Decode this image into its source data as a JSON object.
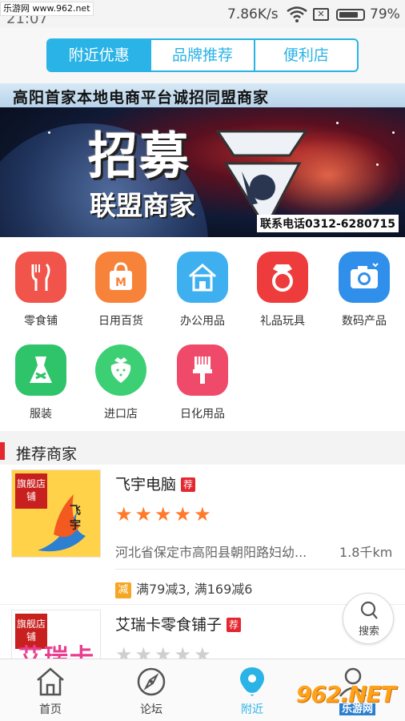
{
  "status_bar": {
    "watermark": "乐游网 www.962.net",
    "time": "21:07",
    "net_speed": "7.86K/s",
    "battery": "79%",
    "icons": [
      "wifi-icon",
      "sim-off-icon",
      "battery-icon"
    ]
  },
  "tabs": [
    {
      "label": "附近优惠",
      "active": true
    },
    {
      "label": "品牌推荐",
      "active": false
    },
    {
      "label": "便利店",
      "active": false
    }
  ],
  "banner": {
    "top_text": "高阳首家本地电商平台诚招同盟商家",
    "headline": "招募",
    "subline": "联盟商家",
    "phone": "联系电话0312-6280715"
  },
  "categories": [
    {
      "label": "零食铺",
      "icon": "fork-knife-icon",
      "color": "#f0544a"
    },
    {
      "label": "日用百货",
      "icon": "shopping-bag-icon",
      "color": "#f7823a"
    },
    {
      "label": "办公用品",
      "icon": "house-icon",
      "color": "#3eb0f0"
    },
    {
      "label": "礼品玩具",
      "icon": "ring-icon",
      "color": "#ee3b3b"
    },
    {
      "label": "数码产品",
      "icon": "camera-icon",
      "color": "#2f8fea"
    },
    {
      "label": "服装",
      "icon": "dress-icon",
      "color": "#2fc46a"
    },
    {
      "label": "进口店",
      "icon": "strawberry-icon",
      "color": "#3ccf73"
    },
    {
      "label": "日化用品",
      "icon": "brush-icon",
      "color": "#f04a6a"
    }
  ],
  "section": {
    "title": "推荐商家"
  },
  "merchants": [
    {
      "flag": "旗舰店铺",
      "thumb_text": "飞宇",
      "name": "飞宇电脑",
      "badge": "荐",
      "rating": 5,
      "address": "河北省保定市高阳县朝阳路妇幼...",
      "distance": "1.8千km",
      "promo_tag": "减",
      "promo": "满79减3, 满169减6"
    },
    {
      "flag": "旗舰店铺",
      "thumb_text": "艾瑞卡",
      "name": "艾瑞卡零食铺子",
      "badge": "荐",
      "rating": 0
    }
  ],
  "search_fab": {
    "label": "搜索",
    "icon": "search-icon"
  },
  "bottom_nav": [
    {
      "label": "首页",
      "icon": "home-icon",
      "active": false
    },
    {
      "label": "论坛",
      "icon": "compass-icon",
      "active": false
    },
    {
      "label": "附近",
      "icon": "location-pin-icon",
      "active": true
    },
    {
      "label": "我的",
      "icon": "user-icon",
      "active": false
    }
  ],
  "corner_watermark": {
    "number": "962.NET",
    "text": "乐游网"
  },
  "colors": {
    "accent": "#2ab3e6",
    "red": "#e4262f",
    "star": "#ff7a2a"
  }
}
